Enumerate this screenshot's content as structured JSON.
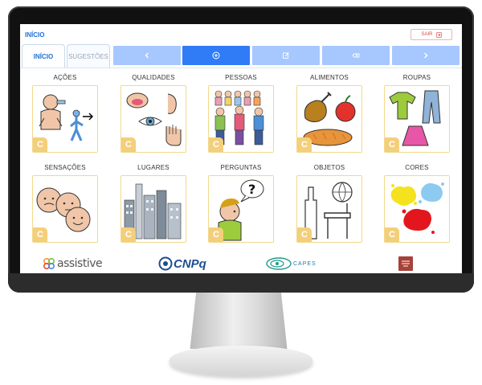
{
  "header": {
    "breadcrumb": "INÍCIO",
    "logout_label": "SAIR"
  },
  "tabs": [
    {
      "label": "INÍCIO",
      "active": true
    },
    {
      "label": "SUGESTÕES",
      "active": false
    }
  ],
  "toolbar": {
    "buttons": [
      {
        "icon": "chevron-left-icon",
        "color": "#a7c7ff"
      },
      {
        "icon": "add-circle-icon",
        "color": "#2f7cf6"
      },
      {
        "icon": "edit-icon",
        "color": "#a7c7ff"
      },
      {
        "icon": "eraser-icon",
        "color": "#a7c7ff"
      },
      {
        "icon": "chevron-right-icon",
        "color": "#a7c7ff"
      }
    ]
  },
  "categories": [
    {
      "label": "AÇÕES",
      "badge": "C"
    },
    {
      "label": "QUALIDADES",
      "badge": "C"
    },
    {
      "label": "PESSOAS",
      "badge": "C"
    },
    {
      "label": "ALIMENTOS",
      "badge": "C"
    },
    {
      "label": "ROUPAS",
      "badge": "C"
    },
    {
      "label": "SENSAÇÕES",
      "badge": "C"
    },
    {
      "label": "LUGARES",
      "badge": "C"
    },
    {
      "label": "PERGUNTAS",
      "badge": "C"
    },
    {
      "label": "OBJETOS",
      "badge": "C"
    },
    {
      "label": "CORES",
      "badge": "C"
    }
  ],
  "sponsors": [
    "assistive",
    "CNPq",
    "CAPES"
  ],
  "colors": {
    "primary": "#2f7cf6",
    "toolbar_light": "#a7c7ff",
    "card_border": "#f2d98c",
    "badge": "#f4cf7a",
    "logout": "#d94b4b"
  }
}
